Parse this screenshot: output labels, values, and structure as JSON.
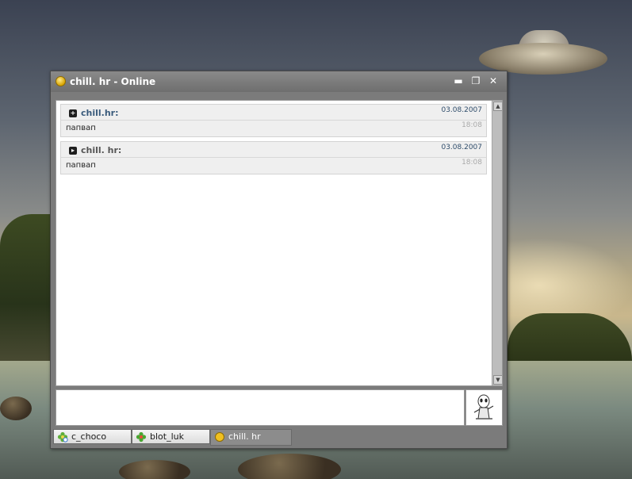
{
  "window": {
    "title": "chill. hr - Online",
    "status_icon": "online-status-icon",
    "buttons": [
      "minimize-icon",
      "restore-icon",
      "close-icon"
    ]
  },
  "messages": [
    {
      "sender": "chill.hr:",
      "date": "03.08.2007",
      "time": "18:08",
      "text": "папвап",
      "sender_color": "#3a5b7c"
    },
    {
      "sender": "chill. hr:",
      "date": "03.08.2007",
      "time": "18:08",
      "text": "папвап",
      "sender_color": "#555555"
    }
  ],
  "compose": {
    "value": "",
    "placeholder": ""
  },
  "tabs": [
    {
      "label": "c_choco",
      "icon": "flower-away-icon",
      "active": false
    },
    {
      "label": "blot_luk",
      "icon": "flower-online-icon",
      "active": false
    },
    {
      "label": "chill. hr",
      "icon": "online-status-icon",
      "active": true
    }
  ],
  "colors": {
    "window_bg": "#7b7b7b",
    "accent_date": "#2f4d6b",
    "status_yellow": "#d8a400"
  }
}
